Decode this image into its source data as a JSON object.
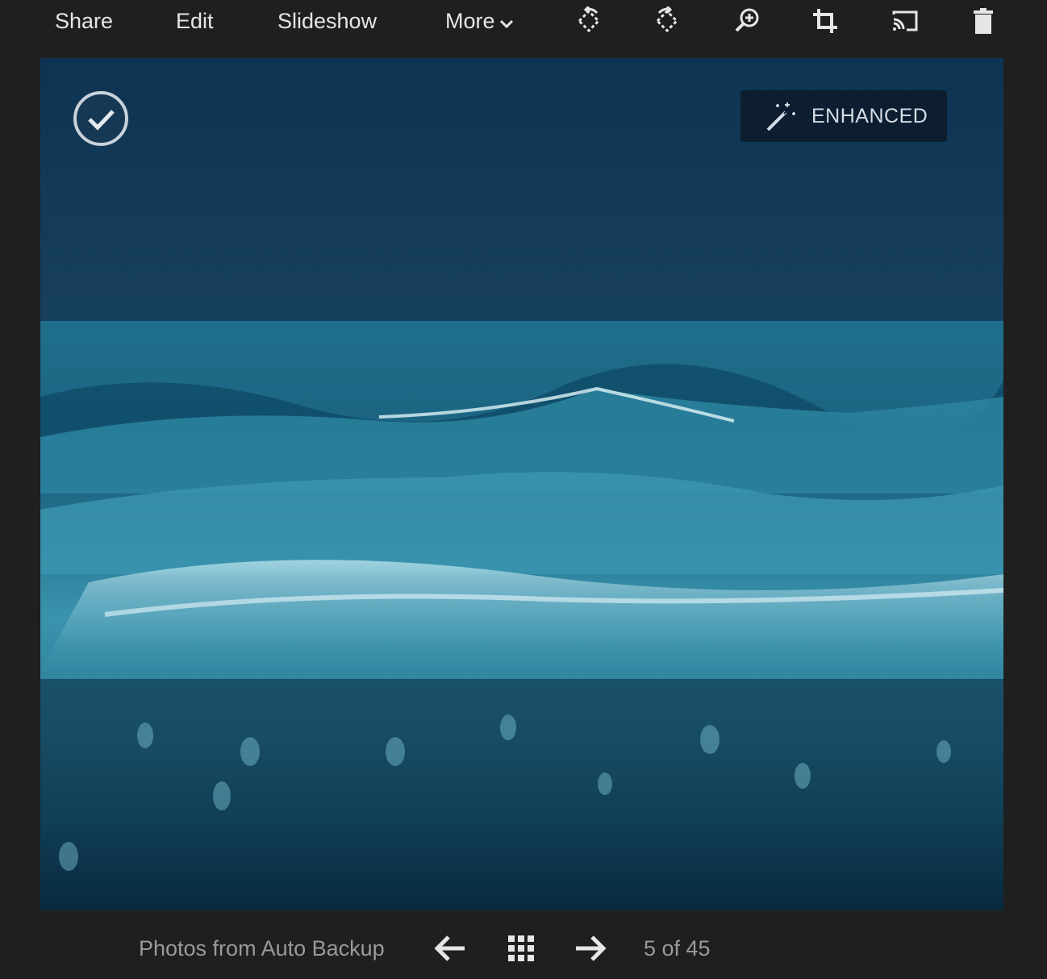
{
  "toolbar": {
    "share_label": "Share",
    "edit_label": "Edit",
    "slideshow_label": "Slideshow",
    "more_label": "More",
    "icons": [
      "rotate-left-icon",
      "rotate-right-icon",
      "zoom-in-icon",
      "crop-icon",
      "cast-icon",
      "trash-icon"
    ]
  },
  "photo": {
    "badge_label": "ENHANCED",
    "badge_icon": "magic-wand-icon",
    "select_icon": "check-circle-icon"
  },
  "footer": {
    "album_label": "Photos from Auto Backup",
    "counter": "5 of 45",
    "icons": [
      "arrow-left-icon",
      "grid-icon",
      "arrow-right-icon"
    ]
  },
  "colors": {
    "background": "#1f1f1f",
    "toolbar_text": "#e6e6e6",
    "footer_text": "#9a9a9a",
    "badge_bg": "#0c1e30"
  }
}
